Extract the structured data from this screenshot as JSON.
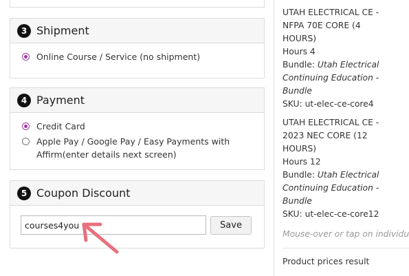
{
  "steps": {
    "shipment": {
      "number": "3",
      "title": "Shipment",
      "options": [
        {
          "label": "Online Course / Service (no shipment)",
          "selected": true
        }
      ]
    },
    "payment": {
      "number": "4",
      "title": "Payment",
      "options": [
        {
          "label": "Credit Card",
          "selected": true
        },
        {
          "label_line1": "Apple Pay / Google Pay / Easy Payments with",
          "label_line2": "Affirm(enter details next screen)",
          "selected": false
        }
      ]
    },
    "coupon": {
      "number": "5",
      "title": "Coupon Discount",
      "input_value": "courses4you",
      "save_label": "Save"
    }
  },
  "cart": {
    "items": [
      {
        "title_lines": [
          "UTAH ELECTRICAL CE -",
          "NFPA 70E CORE (4",
          "HOURS)"
        ],
        "hours": "Hours 4",
        "bundle_label": "Bundle: ",
        "bundle_lines": [
          "Utah Electrical",
          "Continuing Education -",
          "Bundle"
        ],
        "sku": "SKU: ut-elec-ce-core4"
      },
      {
        "title_lines": [
          "UTAH ELECTRICAL CE -",
          "2023 NEC CORE (12",
          "HOURS)"
        ],
        "hours": "Hours 12",
        "bundle_label": "Bundle: ",
        "bundle_lines": [
          "Utah Electrical",
          "Continuing Education -",
          "Bundle"
        ],
        "sku": "SKU: ut-elec-ce-core12"
      }
    ],
    "hint": "Mouse-over or tap on individual ite",
    "prices_note": "Product prices result"
  },
  "colors": {
    "accent": "#a23aa3",
    "arrow": "#e8707e"
  }
}
